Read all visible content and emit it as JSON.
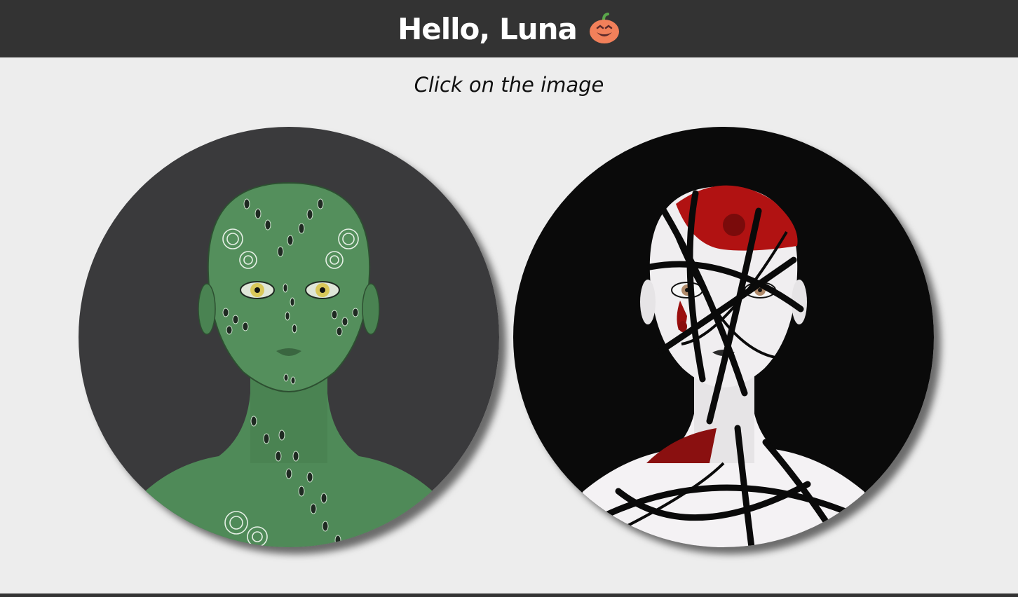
{
  "header": {
    "greeting": "Hello, Luna",
    "icon": "pumpkin-icon"
  },
  "instruction": "Click on the image",
  "avatars": [
    {
      "name": "green-scaled-face-avatar",
      "background": "#3a3a3c",
      "skin": "#4f8a58"
    },
    {
      "name": "shattered-porcelain-face-avatar",
      "background": "#0a0a0a",
      "accent": "#b11212"
    }
  ],
  "colors": {
    "header_bg": "#333333",
    "page_bg": "#ededed",
    "pumpkin": "#f2805a"
  }
}
